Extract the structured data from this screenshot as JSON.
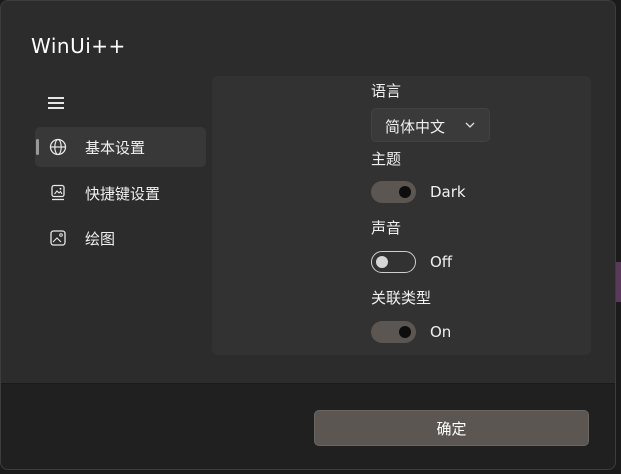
{
  "app": {
    "title": "WinUi++"
  },
  "nav": {
    "items": [
      {
        "label": "基本设置",
        "icon": "globe-icon",
        "selected": true
      },
      {
        "label": "快捷键设置",
        "icon": "shortcut-icon",
        "selected": false
      },
      {
        "label": "绘图",
        "icon": "image-icon",
        "selected": false
      }
    ]
  },
  "settings": {
    "language": {
      "label": "语言",
      "value": "简体中文"
    },
    "theme": {
      "label": "主题",
      "state": "Dark",
      "on": true
    },
    "sound": {
      "label": "声音",
      "state": "Off",
      "on": false
    },
    "association": {
      "label": "关联类型",
      "state": "On",
      "on": true
    }
  },
  "footer": {
    "ok_label": "确定"
  },
  "colors": {
    "panel": "#323232",
    "dialog": "#2c2c2c",
    "toggle_on": "#5b5651",
    "button": "#5b5651"
  }
}
